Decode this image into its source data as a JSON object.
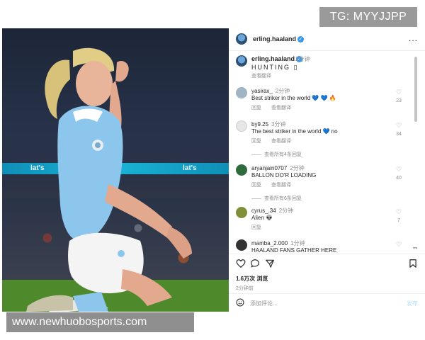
{
  "overlay": {
    "telegram_badge": "TG: MYYJJPP",
    "watermark": "www.newhuobosports.com"
  },
  "photo": {
    "adboard_text": [
      "lat's",
      "lat's"
    ]
  },
  "post": {
    "header": {
      "username": "erling.haaland",
      "more": "..."
    },
    "caption": {
      "username": "erling.haaland",
      "time": "2分钟",
      "text": "HUNTING ▯",
      "translate": "查看翻译"
    },
    "comments": [
      {
        "user": "yasirax_",
        "time": "2分钟",
        "text": "Best striker in the world 💙 💙 🔥",
        "reply": "回复",
        "translate": "查看翻译",
        "likes": "23",
        "avatar_color": "#9fb5c4"
      },
      {
        "user": "by9.25",
        "time": "3分钟",
        "text": "The best striker in the world 💙 no",
        "reply": "回复",
        "translate": "查看翻译",
        "likes": "34",
        "avatar_color": "#e6e6e6",
        "view_all": "查看所有4条回复"
      },
      {
        "user": "aryanjain0707",
        "time": "2分钟",
        "text": "BALLON DO'R LOADING",
        "reply": "回复",
        "translate": "查看翻译",
        "likes": "40",
        "avatar_color": "#2f6b3c",
        "view_all": "查看所有6条回复"
      },
      {
        "user": "cyrus_.34",
        "time": "2分钟",
        "text": "Alien 👽",
        "reply": "回复",
        "translate": "",
        "likes": "7",
        "avatar_color": "#7f8f3a"
      },
      {
        "user": "mamba_2.000",
        "time": "1分钟",
        "text": "HAALAND FANS GATHER HERE",
        "reply": "",
        "translate": "",
        "likes": "",
        "avatar_color": "#333333"
      }
    ],
    "views": "1.6万次 浏览",
    "posted": "2分钟前",
    "add_comment_placeholder": "添加评论...",
    "post_button": "发布"
  },
  "colors": {
    "verified": "#3897f0",
    "secondary_text": "#8e8e8e",
    "sky_blue_kit": "#8cc6ec"
  }
}
